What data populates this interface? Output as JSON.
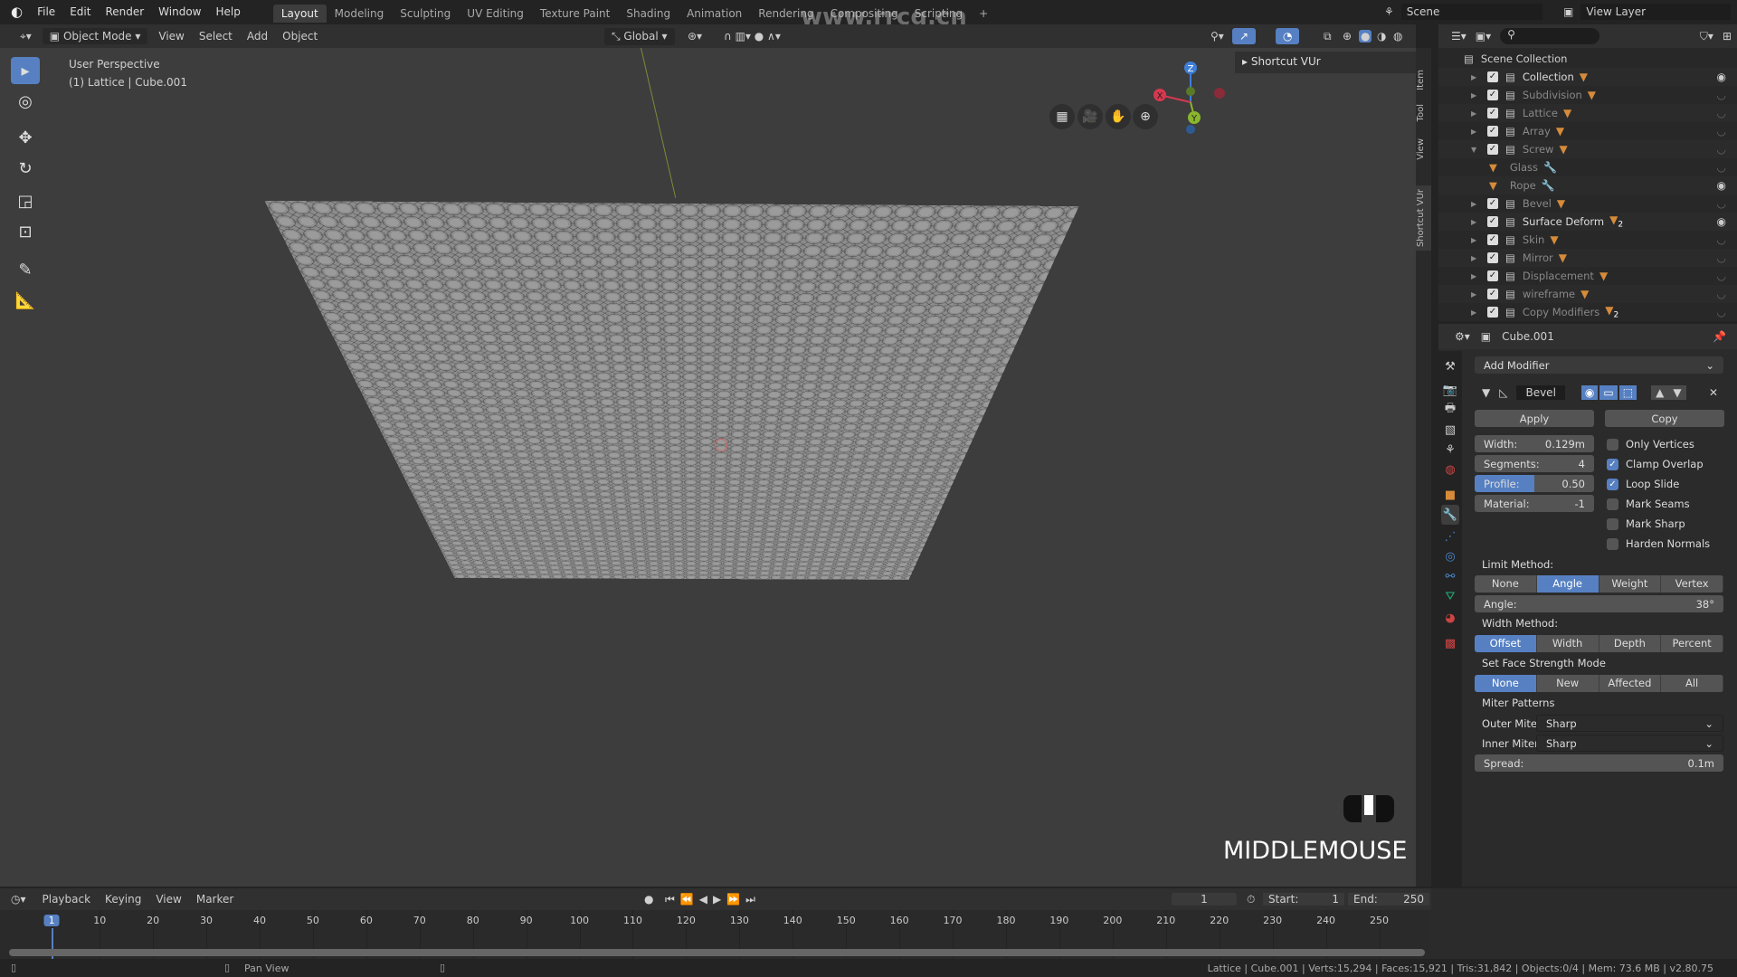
{
  "topbar": {
    "menus": [
      "File",
      "Edit",
      "Render",
      "Window",
      "Help"
    ],
    "workspaces": [
      {
        "label": "Layout",
        "active": true
      },
      {
        "label": "Modeling"
      },
      {
        "label": "Sculpting"
      },
      {
        "label": "UV Editing"
      },
      {
        "label": "Texture Paint"
      },
      {
        "label": "Shading"
      },
      {
        "label": "Animation"
      },
      {
        "label": "Rendering"
      },
      {
        "label": "Compositing"
      },
      {
        "label": "Scripting"
      }
    ],
    "add_tab": "+",
    "scene": "Scene",
    "view_layer": "View Layer",
    "watermark": "www.rrcg.cn"
  },
  "viewport_header": {
    "mode": "Object Mode",
    "menus": [
      "View",
      "Select",
      "Add",
      "Object"
    ],
    "orientation": "Global"
  },
  "viewport": {
    "perspective": "User Perspective",
    "object_info": "(1) Lattice | Cube.001",
    "sidebar_panel": "Shortcut VUr",
    "sidebar_tabs": [
      "Item",
      "Tool",
      "View",
      "Shortcut VUr"
    ],
    "key_overlay": "MIDDLEMOUSE",
    "gizmo": {
      "x": "X",
      "y": "Y",
      "z": "Z"
    }
  },
  "outliner": {
    "root": "Scene Collection",
    "items": [
      {
        "name": "Collection",
        "eye": true,
        "bright": true
      },
      {
        "name": "Subdivision"
      },
      {
        "name": "Lattice"
      },
      {
        "name": "Array"
      },
      {
        "name": "Screw",
        "expanded": true
      },
      {
        "name": "Glass",
        "child": true
      },
      {
        "name": "Rope",
        "child": true,
        "eye": true
      },
      {
        "name": "Bevel"
      },
      {
        "name": "Surface Deform",
        "eye": true,
        "bright": true,
        "badge": "2"
      },
      {
        "name": "Skin"
      },
      {
        "name": "Mirror"
      },
      {
        "name": "Displacement"
      },
      {
        "name": "wireframe"
      },
      {
        "name": "Copy Modifiers",
        "badge": "2"
      }
    ]
  },
  "properties": {
    "object": "Cube.001",
    "add_modifier": "Add Modifier",
    "modifier_name": "Bevel",
    "apply": "Apply",
    "copy": "Copy",
    "fields": [
      {
        "label": "Width:",
        "value": "0.129m"
      },
      {
        "label": "Segments:",
        "value": "4"
      },
      {
        "label": "Profile:",
        "value": "0.50",
        "fill": 0.5
      },
      {
        "label": "Material:",
        "value": "-1"
      }
    ],
    "checks": [
      {
        "label": "Only Vertices",
        "on": false
      },
      {
        "label": "Clamp Overlap",
        "on": true
      },
      {
        "label": "Loop Slide",
        "on": true
      },
      {
        "label": "Mark Seams",
        "on": false
      },
      {
        "label": "Mark Sharp",
        "on": false
      },
      {
        "label": "Harden Normals",
        "on": false
      }
    ],
    "limit_method": {
      "label": "Limit Method:",
      "options": [
        "None",
        "Angle",
        "Weight",
        "Vertex Group"
      ],
      "selected": "Angle"
    },
    "angle": {
      "label": "Angle:",
      "value": "38°"
    },
    "width_method": {
      "label": "Width Method:",
      "options": [
        "Offset",
        "Width",
        "Depth",
        "Percent"
      ],
      "selected": "Offset"
    },
    "face_strength": {
      "label": "Set Face Strength Mode",
      "options": [
        "None",
        "New",
        "Affected",
        "All"
      ],
      "selected": "None"
    },
    "miter_label": "Miter Patterns",
    "outer_miter": {
      "label": "Outer Miter:",
      "value": "Sharp"
    },
    "inner_miter": {
      "label": "Inner Miter:",
      "value": "Sharp"
    },
    "spread": {
      "label": "Spread:",
      "value": "0.1m"
    }
  },
  "timeline": {
    "menus": [
      "Playback",
      "Keying",
      "View",
      "Marker"
    ],
    "current_frame": "1",
    "start_label": "Start:",
    "start": "1",
    "end_label": "End:",
    "end": "250",
    "ticks": [
      "1",
      "10",
      "20",
      "30",
      "40",
      "50",
      "60",
      "70",
      "80",
      "90",
      "100",
      "110",
      "120",
      "130",
      "140",
      "150",
      "160",
      "170",
      "180",
      "190",
      "200",
      "210",
      "220",
      "230",
      "240",
      "250"
    ]
  },
  "status": {
    "hint": "Pan View",
    "info": "Lattice | Cube.001 | Verts:15,294 | Faces:15,921 | Tris:31,842 | Objects:0/4 | Mem: 73.6 MB | v2.80.75"
  },
  "colors": {
    "accent": "#5680c2",
    "object_icon": "#d68b3a",
    "mesh_data": "#22b07a"
  }
}
